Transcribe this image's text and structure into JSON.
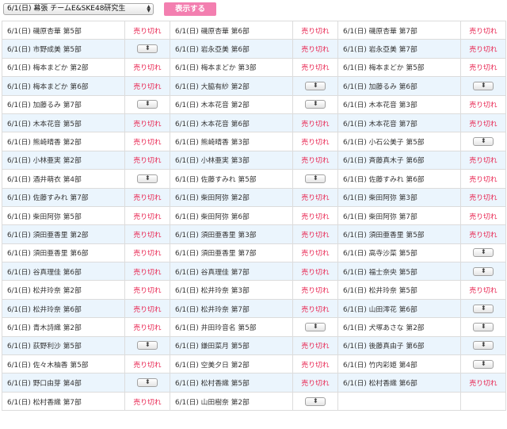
{
  "event_select": {
    "value": "6/1(日) 幕張 チームE&SKE48研究生"
  },
  "show_button": {
    "label": "表示する"
  },
  "sold_out_label": "売り切れ",
  "rows": [
    [
      {
        "label": "6/1(日) 磯原杏華 第5部",
        "status": "soldout"
      },
      {
        "label": "6/1(日) 磯原杏華 第6部",
        "status": "soldout"
      },
      {
        "label": "6/1(日) 磯原杏華 第7部",
        "status": "soldout"
      }
    ],
    [
      {
        "label": "6/1(日) 市野成美 第5部",
        "status": "select"
      },
      {
        "label": "6/1(日) 岩永亞美 第6部",
        "status": "soldout"
      },
      {
        "label": "6/1(日) 岩永亞美 第7部",
        "status": "soldout"
      }
    ],
    [
      {
        "label": "6/1(日) 梅本まどか 第2部",
        "status": "soldout"
      },
      {
        "label": "6/1(日) 梅本まどか 第3部",
        "status": "soldout"
      },
      {
        "label": "6/1(日) 梅本まどか 第5部",
        "status": "soldout"
      }
    ],
    [
      {
        "label": "6/1(日) 梅本まどか 第6部",
        "status": "soldout"
      },
      {
        "label": "6/1(日) 大脇有紗 第2部",
        "status": "select"
      },
      {
        "label": "6/1(日) 加藤るみ 第6部",
        "status": "select"
      }
    ],
    [
      {
        "label": "6/1(日) 加藤るみ 第7部",
        "status": "select"
      },
      {
        "label": "6/1(日) 木本花音 第2部",
        "status": "select"
      },
      {
        "label": "6/1(日) 木本花音 第3部",
        "status": "soldout"
      }
    ],
    [
      {
        "label": "6/1(日) 木本花音 第5部",
        "status": "soldout"
      },
      {
        "label": "6/1(日) 木本花音 第6部",
        "status": "soldout"
      },
      {
        "label": "6/1(日) 木本花音 第7部",
        "status": "soldout"
      }
    ],
    [
      {
        "label": "6/1(日) 熊崎晴香 第2部",
        "status": "soldout"
      },
      {
        "label": "6/1(日) 熊崎晴香 第3部",
        "status": "soldout"
      },
      {
        "label": "6/1(日) 小石公美子 第5部",
        "status": "select"
      }
    ],
    [
      {
        "label": "6/1(日) 小林亜実 第2部",
        "status": "soldout"
      },
      {
        "label": "6/1(日) 小林亜実 第3部",
        "status": "soldout"
      },
      {
        "label": "6/1(日) 斉藤真木子 第6部",
        "status": "soldout"
      }
    ],
    [
      {
        "label": "6/1(日) 酒井萌衣 第4部",
        "status": "select"
      },
      {
        "label": "6/1(日) 佐藤すみれ 第5部",
        "status": "select"
      },
      {
        "label": "6/1(日) 佐藤すみれ 第6部",
        "status": "soldout"
      }
    ],
    [
      {
        "label": "6/1(日) 佐藤すみれ 第7部",
        "status": "soldout"
      },
      {
        "label": "6/1(日) 柴田阿弥 第2部",
        "status": "soldout"
      },
      {
        "label": "6/1(日) 柴田阿弥 第3部",
        "status": "soldout"
      }
    ],
    [
      {
        "label": "6/1(日) 柴田阿弥 第5部",
        "status": "soldout"
      },
      {
        "label": "6/1(日) 柴田阿弥 第6部",
        "status": "soldout"
      },
      {
        "label": "6/1(日) 柴田阿弥 第7部",
        "status": "soldout"
      }
    ],
    [
      {
        "label": "6/1(日) 須田亜香里 第2部",
        "status": "soldout"
      },
      {
        "label": "6/1(日) 須田亜香里 第3部",
        "status": "soldout"
      },
      {
        "label": "6/1(日) 須田亜香里 第5部",
        "status": "soldout"
      }
    ],
    [
      {
        "label": "6/1(日) 須田亜香里 第6部",
        "status": "soldout"
      },
      {
        "label": "6/1(日) 須田亜香里 第7部",
        "status": "soldout"
      },
      {
        "label": "6/1(日) 高寺沙菜 第5部",
        "status": "select"
      }
    ],
    [
      {
        "label": "6/1(日) 谷真理佳 第6部",
        "status": "soldout"
      },
      {
        "label": "6/1(日) 谷真理佳 第7部",
        "status": "soldout"
      },
      {
        "label": "6/1(日) 福士奈央 第5部",
        "status": "select"
      }
    ],
    [
      {
        "label": "6/1(日) 松井玲奈 第2部",
        "status": "soldout"
      },
      {
        "label": "6/1(日) 松井玲奈 第3部",
        "status": "soldout"
      },
      {
        "label": "6/1(日) 松井玲奈 第5部",
        "status": "soldout"
      }
    ],
    [
      {
        "label": "6/1(日) 松井玲奈 第6部",
        "status": "soldout"
      },
      {
        "label": "6/1(日) 松井玲奈 第7部",
        "status": "soldout"
      },
      {
        "label": "6/1(日) 山田澪花 第6部",
        "status": "select"
      }
    ],
    [
      {
        "label": "6/1(日) 青木詩織 第2部",
        "status": "soldout"
      },
      {
        "label": "6/1(日) 井田玲音名 第5部",
        "status": "select"
      },
      {
        "label": "6/1(日) 犬塚あさな 第2部",
        "status": "select"
      }
    ],
    [
      {
        "label": "6/1(日) 荻野利沙 第5部",
        "status": "select"
      },
      {
        "label": "6/1(日) 鎌田菜月 第5部",
        "status": "soldout"
      },
      {
        "label": "6/1(日) 後藤真由子 第6部",
        "status": "select"
      }
    ],
    [
      {
        "label": "6/1(日) 佐々木柚香 第5部",
        "status": "soldout"
      },
      {
        "label": "6/1(日) 空美夕日 第2部",
        "status": "soldout"
      },
      {
        "label": "6/1(日) 竹内彩姫 第4部",
        "status": "select"
      }
    ],
    [
      {
        "label": "6/1(日) 野口由芽 第4部",
        "status": "select"
      },
      {
        "label": "6/1(日) 松村香織 第5部",
        "status": "soldout"
      },
      {
        "label": "6/1(日) 松村香織 第6部",
        "status": "soldout"
      }
    ],
    [
      {
        "label": "6/1(日) 松村香織 第7部",
        "status": "soldout"
      },
      {
        "label": "6/1(日) 山田樹奈 第2部",
        "status": "select"
      },
      null
    ]
  ]
}
